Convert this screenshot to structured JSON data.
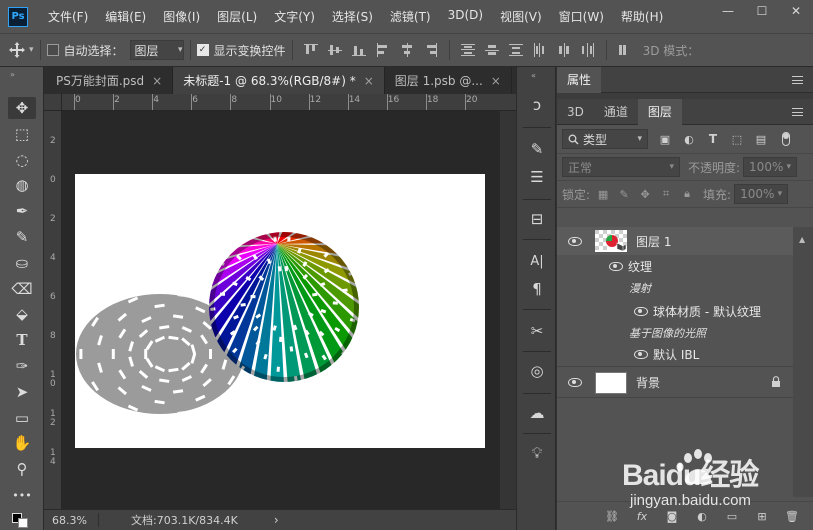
{
  "app": {
    "logo": "Ps",
    "accent": "#31a8ff"
  },
  "menu": [
    "文件(F)",
    "编辑(E)",
    "图像(I)",
    "图层(L)",
    "文字(Y)",
    "选择(S)",
    "滤镜(T)",
    "3D(D)",
    "视图(V)",
    "窗口(W)",
    "帮助(H)"
  ],
  "window_controls": {
    "minimize": "—",
    "maximize": "☐",
    "close": "✕"
  },
  "options": {
    "auto_select_label": "自动选择：",
    "auto_select_checked": false,
    "target_value": "图层",
    "show_transform_label": "显示变换控件",
    "show_transform_checked": true,
    "mode_3d_label": "3D 模式："
  },
  "tabs": [
    {
      "label": "PS万能封面.psd",
      "active": false
    },
    {
      "label": "未标题-1 @ 68.3%(RGB/8#) *",
      "active": true
    },
    {
      "label": "图层 1.psb @...",
      "active": false
    }
  ],
  "rulers": {
    "top": [
      "0",
      "2",
      "4",
      "6",
      "8",
      "10",
      "12",
      "14",
      "16",
      "18",
      "20"
    ],
    "left": [
      "2",
      "0",
      "2",
      "4",
      "6",
      "8",
      "1\n0",
      "1\n2",
      "1\n4"
    ]
  },
  "status": {
    "zoom": "68.3%",
    "doc": "文档:703.1K/834.4K",
    "arrow": "›"
  },
  "panel": {
    "title_tab": "属性",
    "tabs": [
      "3D",
      "通道",
      "图层"
    ],
    "active_tab": "图层",
    "filter_kind": "类型",
    "blend_mode": "正常",
    "opacity_label": "不透明度:",
    "opacity_value": "100%",
    "lock_label": "锁定:",
    "fill_label": "填充:",
    "fill_value": "100%"
  },
  "layers": [
    {
      "name": "图层 1",
      "type": "3d-layer"
    },
    {
      "name": "纹理",
      "type": "sub"
    },
    {
      "name": "漫射",
      "type": "group-label"
    },
    {
      "name": "球体材质 - 默认纹理",
      "type": "sub2"
    },
    {
      "name": "基于图像的光照",
      "type": "group-label"
    },
    {
      "name": "默认 IBL",
      "type": "sub2"
    },
    {
      "name": "背景",
      "type": "background"
    }
  ],
  "footer_icons": [
    "link-icon",
    "fx-icon",
    "mask-icon",
    "adjustment-icon",
    "folder-icon",
    "new-layer-icon",
    "trash-icon"
  ],
  "watermark": {
    "text": "Baidu经验",
    "subtext": "jingyan.baidu.com"
  }
}
